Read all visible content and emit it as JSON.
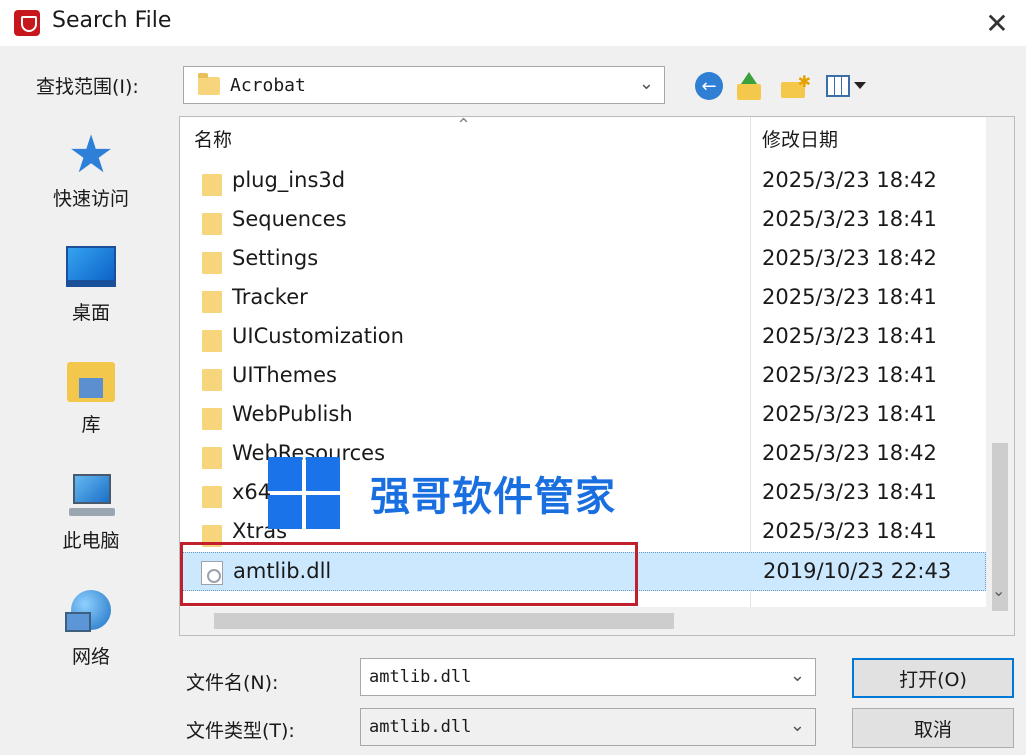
{
  "window": {
    "title": "Search File",
    "close_glyph": "✕"
  },
  "toolbar": {
    "look_in_label": "查找范围(I):",
    "look_in_value": "Acrobat",
    "back_glyph": "←",
    "icons": [
      "back-icon",
      "up-folder-icon",
      "new-folder-icon",
      "view-menu-icon"
    ]
  },
  "places": [
    {
      "label": "快速访问",
      "icon": "star-icon"
    },
    {
      "label": "桌面",
      "icon": "desktop-icon"
    },
    {
      "label": "库",
      "icon": "library-icon"
    },
    {
      "label": "此电脑",
      "icon": "computer-icon"
    },
    {
      "label": "网络",
      "icon": "network-icon"
    }
  ],
  "file_list": {
    "columns": {
      "name": "名称",
      "date": "修改日期"
    },
    "rows": [
      {
        "name": "plug_ins3d",
        "date": "2025/3/23 18:42",
        "type": "folder"
      },
      {
        "name": "Sequences",
        "date": "2025/3/23 18:41",
        "type": "folder"
      },
      {
        "name": "Settings",
        "date": "2025/3/23 18:42",
        "type": "folder"
      },
      {
        "name": "Tracker",
        "date": "2025/3/23 18:41",
        "type": "folder"
      },
      {
        "name": "UICustomization",
        "date": "2025/3/23 18:41",
        "type": "folder"
      },
      {
        "name": "UIThemes",
        "date": "2025/3/23 18:41",
        "type": "folder"
      },
      {
        "name": "WebPublish",
        "date": "2025/3/23 18:41",
        "type": "folder"
      },
      {
        "name": "WebResources",
        "date": "2025/3/23 18:42",
        "type": "folder"
      },
      {
        "name": "x64",
        "date": "2025/3/23 18:41",
        "type": "folder"
      },
      {
        "name": "Xtras",
        "date": "2025/3/23 18:41",
        "type": "folder"
      },
      {
        "name": "amtlib.dll",
        "date": "2019/10/23 22:43",
        "type": "file",
        "selected": true
      }
    ]
  },
  "watermark": {
    "text": "强哥软件管家",
    "color": "#1a6fe0"
  },
  "bottom": {
    "filename_label": "文件名(N):",
    "filename_value": "amtlib.dll",
    "filetype_label": "文件类型(T):",
    "filetype_value": "amtlib.dll",
    "open_button": "打开(O)",
    "cancel_button": "取消"
  },
  "colors": {
    "accent": "#0078d7",
    "selection": "#cce8ff",
    "highlight_box": "#c0202c",
    "folder": "#f6d57c"
  }
}
